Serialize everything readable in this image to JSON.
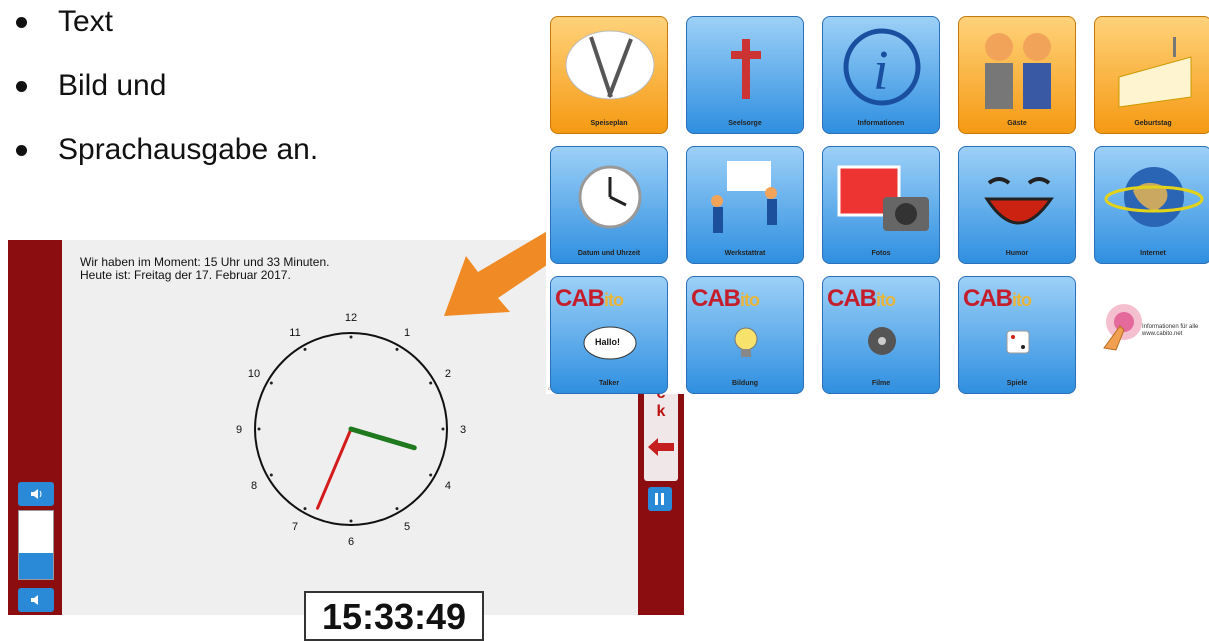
{
  "bullets": [
    "Text",
    "Bild und",
    "Sprachausgabe an."
  ],
  "clock": {
    "line1": "Wir haben im Moment: 15 Uhr und 33 Minuten.",
    "line2": "Heute ist: Freitag der 17. Februar 2017.",
    "numbers": [
      "12",
      "1",
      "2",
      "3",
      "4",
      "5",
      "6",
      "7",
      "8",
      "9",
      "10",
      "11"
    ],
    "digital": "15:33:49",
    "hour": 15,
    "minute": 33,
    "second": 49,
    "back_letters": [
      "c",
      "k"
    ],
    "colors": {
      "frame": "#8b0d10",
      "hour_hand": "#1f7a1f",
      "minute_hand": "#d41c1c",
      "button": "#2a8ad8"
    }
  },
  "tiles": [
    {
      "label": "Speiseplan",
      "color": "orange",
      "icon": "plate-icon"
    },
    {
      "label": "Seelsorge",
      "color": "blue",
      "icon": "cross-icon"
    },
    {
      "label": "Informationen",
      "color": "blue",
      "icon": "info-icon"
    },
    {
      "label": "Gäste",
      "color": "orange",
      "icon": "handshake-icon"
    },
    {
      "label": "Geburtstag",
      "color": "orange",
      "icon": "cake-icon"
    },
    {
      "label": "Datum und Uhrzeit",
      "color": "blue",
      "icon": "clock-icon"
    },
    {
      "label": "Werkstattrat",
      "color": "blue",
      "icon": "people-icon"
    },
    {
      "label": "Fotos",
      "color": "blue",
      "icon": "camera-icon"
    },
    {
      "label": "Humor",
      "color": "blue",
      "icon": "laughing-face-icon"
    },
    {
      "label": "Internet",
      "color": "blue",
      "icon": "globe-icon"
    },
    {
      "label": "Talker",
      "color": "blue",
      "icon": "speech-bubble-icon",
      "cab": true
    },
    {
      "label": "Bildung",
      "color": "blue",
      "icon": "lightbulb-icon",
      "cab": true
    },
    {
      "label": "Filme",
      "color": "blue",
      "icon": "film-reel-icon",
      "cab": true
    },
    {
      "label": "Spiele",
      "color": "blue",
      "icon": "dice-icon",
      "cab": true
    }
  ],
  "cab_logo": {
    "main": "CAB",
    "sub": "ito"
  },
  "talker_bubble": "Hallo!",
  "info": {
    "text": "Informationen für alle www.cabito.net",
    "icon": "pointing-hand-icon"
  }
}
